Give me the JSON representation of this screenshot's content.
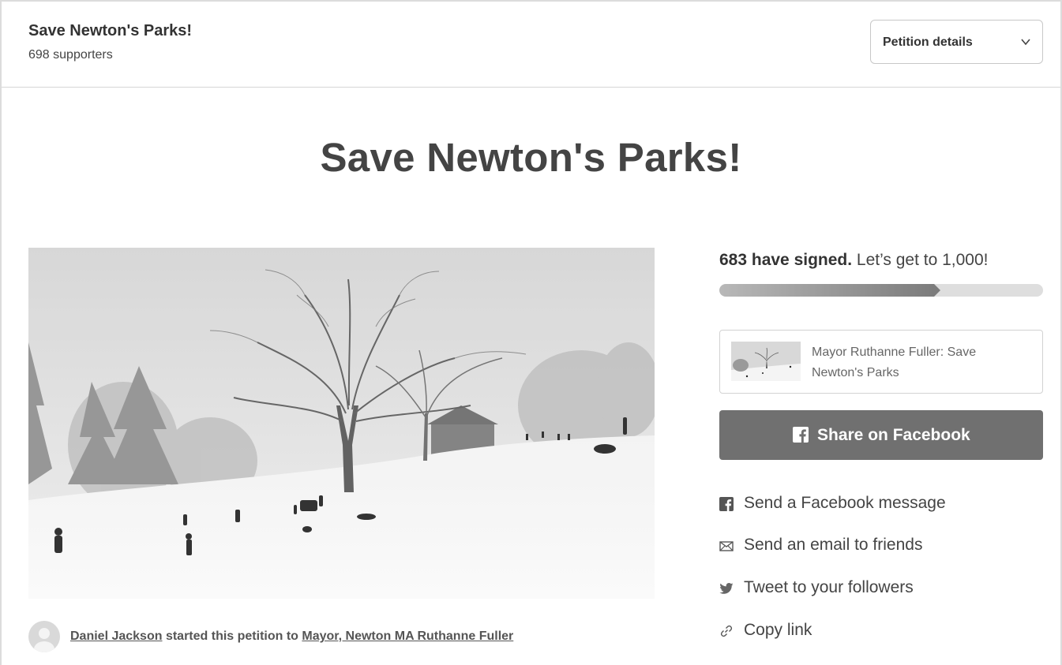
{
  "header": {
    "title": "Save Newton's Parks!",
    "supporters": "698 supporters",
    "details_label": "Petition details",
    "details_icon": "chevron-down-icon"
  },
  "petition": {
    "headline": "Save Newton's Parks!",
    "photo_icon": "snowy-park-photo"
  },
  "starter": {
    "name": "Daniel Jackson",
    "middle_text": " started this petition to ",
    "target": "Mayor, Newton MA Ruthanne Fuller",
    "avatar_icon": "avatar-placeholder-icon"
  },
  "progress": {
    "signed_count_text": "683 have signed.",
    "goal_text": " Let’s get to 1,000!",
    "signed": 683,
    "goal": 1000
  },
  "share": {
    "preview_text": "Mayor Ruthanne Fuller: Save Newton's Parks",
    "facebook_button": "Share on Facebook",
    "links": [
      {
        "label": "Send a Facebook message",
        "icon": "facebook-icon"
      },
      {
        "label": "Send an email to friends",
        "icon": "email-icon"
      },
      {
        "label": "Tweet to your followers",
        "icon": "twitter-icon"
      },
      {
        "label": "Copy link",
        "icon": "link-icon"
      }
    ]
  },
  "colors": {
    "button_bg": "#707070",
    "progress_track": "#dedede",
    "progress_fill": "#7c7c7c",
    "text": "#333333"
  }
}
